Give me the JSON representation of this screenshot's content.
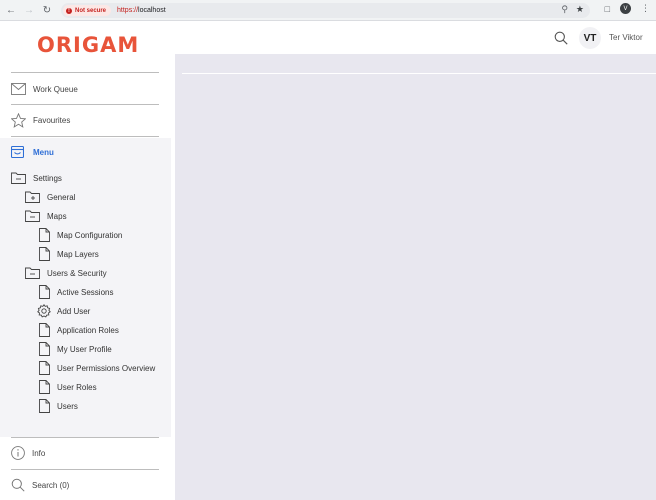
{
  "browser": {
    "security_label": "Not secure",
    "url_scheme": "https://",
    "url_host": "localhost",
    "profile_initial": "V"
  },
  "app": {
    "logo": "ORIGAM",
    "user_initials": "VT",
    "user_name": "Ter Viktor"
  },
  "sidebar": {
    "work_queue": "Work Queue",
    "favourites": "Favourites",
    "menu": "Menu",
    "info": "Info",
    "search": "Search (0)"
  },
  "tree": {
    "settings": "Settings",
    "general": "General",
    "maps": "Maps",
    "map_configuration": "Map Configuration",
    "map_layers": "Map Layers",
    "users_security": "Users & Security",
    "active_sessions": "Active Sessions",
    "add_user": "Add User",
    "application_roles": "Application Roles",
    "my_user_profile": "My User Profile",
    "user_permissions_overview": "User Permissions Overview",
    "user_roles": "User Roles",
    "users": "Users"
  },
  "colors": {
    "brand": "#e8543a",
    "accent": "#2f6fd6",
    "main_bg": "#e8e7ef",
    "menu_bg": "#f4f4f7"
  }
}
